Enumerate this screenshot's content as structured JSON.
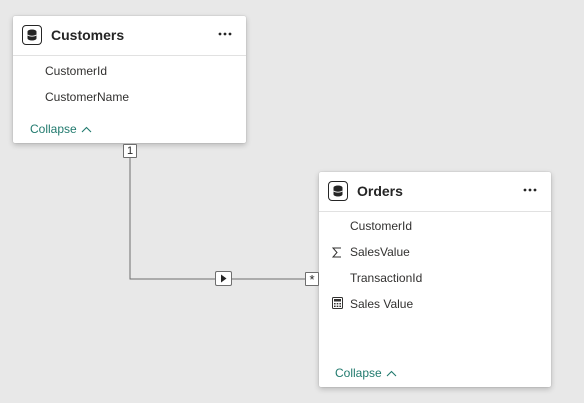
{
  "tables": {
    "customers": {
      "name": "Customers",
      "icon": "database-icon",
      "fields": [
        {
          "name": "CustomerId",
          "icon": ""
        },
        {
          "name": "CustomerName",
          "icon": ""
        }
      ],
      "collapse_label": "Collapse"
    },
    "orders": {
      "name": "Orders",
      "icon": "database-icon",
      "fields": [
        {
          "name": "CustomerId",
          "icon": ""
        },
        {
          "name": "SalesValue",
          "icon": "sigma-icon"
        },
        {
          "name": "TransactionId",
          "icon": ""
        },
        {
          "name": "Sales Value",
          "icon": "calculator-icon"
        }
      ],
      "collapse_label": "Collapse"
    }
  },
  "relationship": {
    "from_cardinality": "1",
    "to_cardinality": "*",
    "direction_icon": "play-icon"
  },
  "more_icon": "ellipsis-icon",
  "colors": {
    "canvas": "#e8e8e8",
    "accent": "#217a6e",
    "line": "#6e6e6e",
    "text": "#252525"
  }
}
